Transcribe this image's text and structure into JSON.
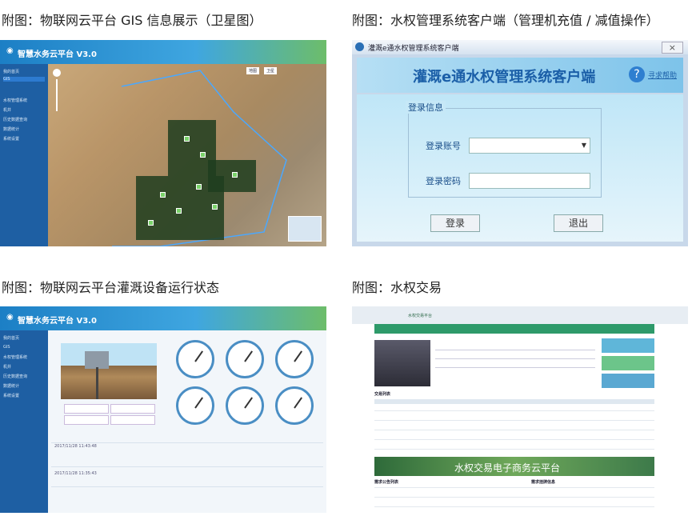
{
  "captions": {
    "gis": "附图：物联网云平台 GIS 信息展示（卫星图）",
    "client": "附图：水权管理系统客户端（管理机充值 / 减值操作）",
    "status": "附图：物联网云平台灌溉设备运行状态",
    "trade": "附图：水权交易"
  },
  "gis_panel": {
    "app_title": "智慧水务云平台 V3.0",
    "sidebar_items": [
      "我的首页",
      "GIS",
      "",
      "水权管理系统",
      "机井",
      "历史数据查询",
      "数据统计",
      "系统设置"
    ],
    "map_buttons": [
      "地图",
      "卫星",
      "",
      "",
      ""
    ]
  },
  "client_panel": {
    "window_title": "灌溉e通水权管理系统客户端",
    "banner_title": "灌溉e通水权管理系统客户端",
    "help_label": "寻求帮助",
    "login_section": "登录信息",
    "account_label": "登录账号",
    "password_label": "登录密码",
    "login_button": "登录",
    "exit_button": "退出",
    "close_button": "×"
  },
  "status_panel": {
    "app_title": "智慧水务云平台 V3.0",
    "sidebar_items": [
      "我的首页",
      "GIS",
      "水权管理系统",
      "机井",
      "历史数据查询",
      "数据统计",
      "系统设置"
    ],
    "time1": "2017/11/28 11:43:48",
    "time2": "2017/11/28 11:35:43"
  },
  "trade_panel": {
    "site_title": "水权交易平台",
    "banner_text": "水权交易电子商务云平台",
    "section1": "交易列表",
    "section2": "需求公告列表",
    "section3": "需求挂牌信息"
  },
  "colors": {
    "header_blue": "#1c7fc5",
    "sidebar_blue": "#1e5fa3",
    "trade_green": "#2e9a6a"
  }
}
